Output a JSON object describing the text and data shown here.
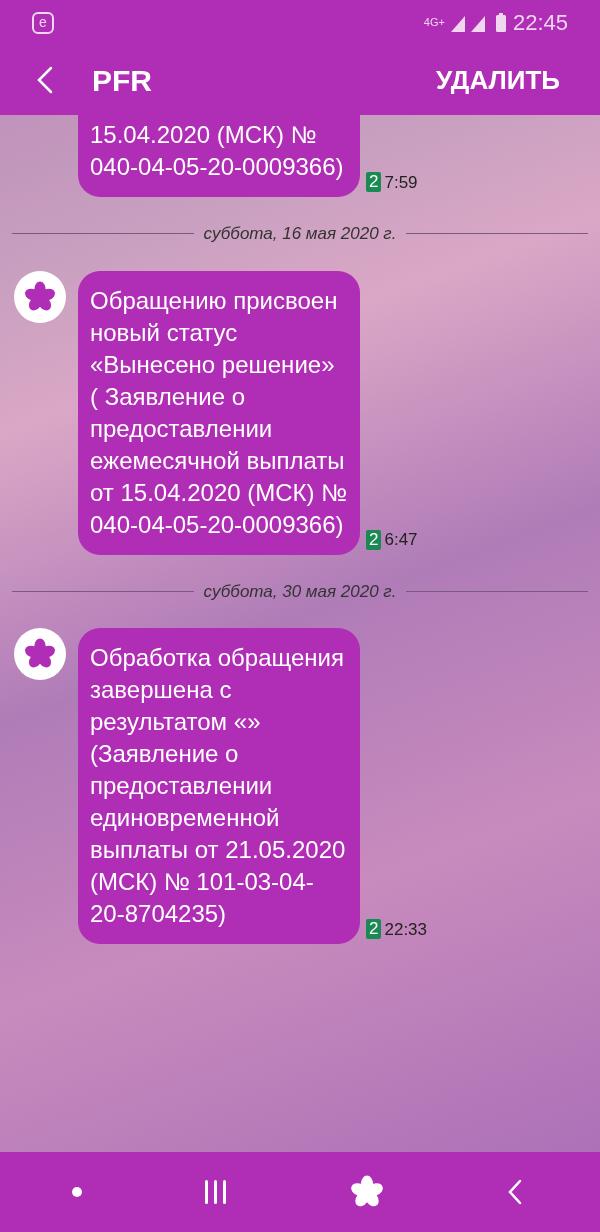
{
  "status_bar": {
    "notification": "e",
    "network": "4G+",
    "time": "22:45"
  },
  "header": {
    "title": "PFR",
    "action": "УДАЛИТЬ"
  },
  "thread": [
    {
      "kind": "message",
      "avatar": false,
      "text": "15.04.2020 (МСК) № 040-04-05-20-0009366)",
      "sim": "2",
      "time": "7:59"
    },
    {
      "kind": "date",
      "text": "суббота, 16 мая 2020 г."
    },
    {
      "kind": "message",
      "avatar": true,
      "text": "Обращению присвоен новый статус «Вынесено решение» ( Заявление о предоставлении ежемесячной выплаты от 15.04.2020 (МСК) № 040-04-05-20-0009366)",
      "sim": "2",
      "time": "6:47"
    },
    {
      "kind": "date",
      "text": "суббота, 30 мая 2020 г."
    },
    {
      "kind": "message",
      "avatar": true,
      "text": "Обработка обращения завершена с результатом «» (Заявление о предоставлении единовременной выплаты от 21.05.2020 (МСК) № 101-03-04-20-8704235)",
      "sim": "2",
      "time": "22:33"
    }
  ]
}
